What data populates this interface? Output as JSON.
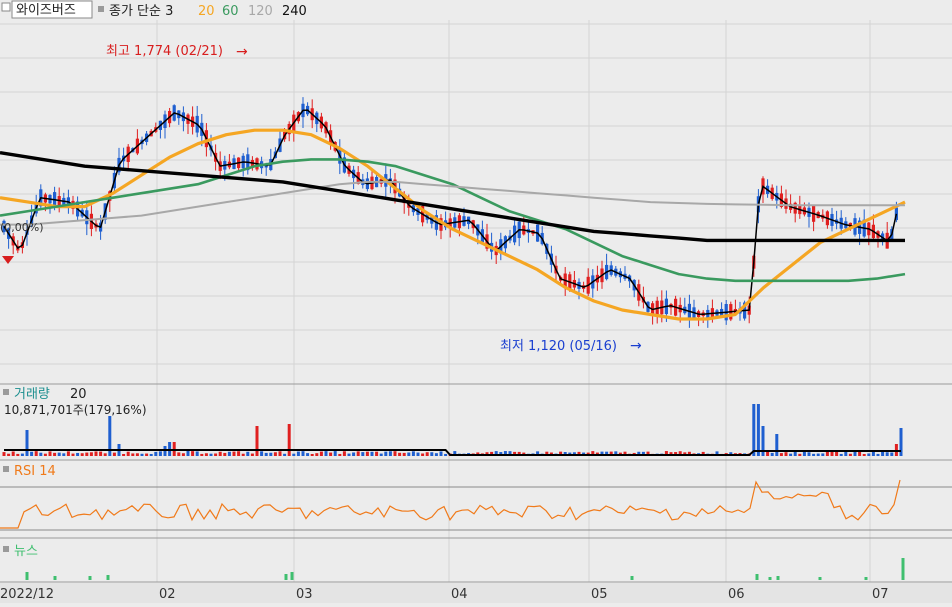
{
  "header": {
    "stock_name": "와이즈버즈",
    "price_label": "종가 단순 3",
    "ma_periods": [
      {
        "label": "20",
        "color": "#f5a623"
      },
      {
        "label": "60",
        "color": "#3a9a5f"
      },
      {
        "label": "120",
        "color": "#a8a8a8"
      },
      {
        "label": "240",
        "color": "#000000"
      }
    ]
  },
  "annotations": {
    "high": "최고 1,774 (02/21)",
    "low": "최저 1,120 (05/16)",
    "left_value": "(0,00%)",
    "high_arrow": "→",
    "low_arrow": "→"
  },
  "volume_panel": {
    "title": "거래량",
    "period": "20",
    "value": "10,871,701주(179,16%)"
  },
  "rsi_panel": {
    "title": "RSI 14"
  },
  "news_panel": {
    "title": "뉴스"
  },
  "x_axis": {
    "labels": [
      "2022/12",
      "02",
      "03",
      "04",
      "05",
      "06",
      "07"
    ]
  },
  "colors": {
    "up": "#e02020",
    "down": "#1f5fd0",
    "ma3": "#000000",
    "ma20": "#f5a623",
    "ma60": "#3a9a5f",
    "ma120": "#a8a8a8",
    "ma240": "#000000",
    "rsi": "#f07a1a",
    "news": "#3fbf6f",
    "grid": "#d4d4d4",
    "background": "#ececec"
  },
  "chart_data": {
    "type": "candlestick",
    "title": "와이즈버즈",
    "y_high": 1774,
    "y_low": 1120,
    "series": [
      {
        "name": "20",
        "values": [
          1450,
          1440,
          1430,
          1430,
          1460,
          1500,
          1540,
          1570,
          1590,
          1600,
          1600,
          1590,
          1560,
          1520,
          1470,
          1420,
          1380,
          1350,
          1320,
          1290,
          1250,
          1220,
          1200,
          1190,
          1180,
          1180,
          1190,
          1250,
          1300,
          1350,
          1380,
          1410,
          1440
        ]
      },
      {
        "name": "60",
        "values": [
          1410,
          1420,
          1430,
          1440,
          1450,
          1460,
          1470,
          1480,
          1500,
          1520,
          1530,
          1535,
          1535,
          1530,
          1520,
          1500,
          1480,
          1450,
          1420,
          1400,
          1380,
          1350,
          1320,
          1300,
          1280,
          1270,
          1265,
          1265,
          1265,
          1265,
          1265,
          1270,
          1280
        ]
      },
      {
        "name": "120",
        "values": [
          1390,
          1390,
          1395,
          1400,
          1405,
          1410,
          1420,
          1430,
          1440,
          1450,
          1460,
          1470,
          1480,
          1485,
          1485,
          1480,
          1475,
          1470,
          1465,
          1460,
          1455,
          1450,
          1445,
          1440,
          1438,
          1436,
          1435,
          1434,
          1433,
          1433,
          1433,
          1433,
          1433
        ]
      },
      {
        "name": "240",
        "values": [
          1550,
          1540,
          1530,
          1520,
          1515,
          1510,
          1505,
          1500,
          1495,
          1490,
          1485,
          1475,
          1465,
          1455,
          1445,
          1435,
          1425,
          1415,
          1405,
          1395,
          1385,
          1375,
          1370,
          1365,
          1360,
          1355,
          1355,
          1355,
          1355,
          1355,
          1355,
          1355,
          1355
        ]
      }
    ],
    "x_labels": [
      "2022/12",
      "02",
      "03",
      "04",
      "05",
      "06",
      "07"
    ],
    "legend": "top-left",
    "grid": true
  }
}
